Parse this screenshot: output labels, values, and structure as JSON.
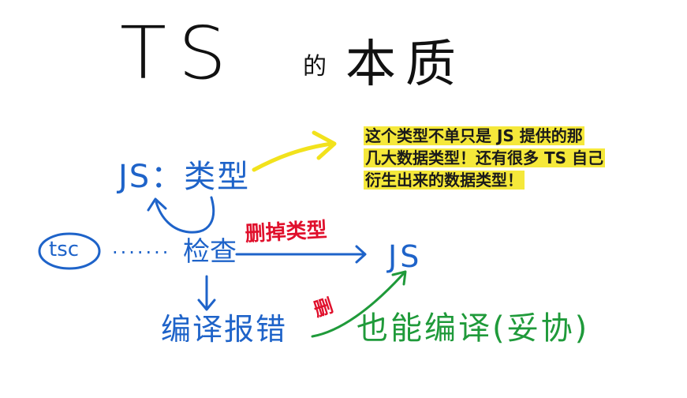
{
  "title": {
    "ts": "TS",
    "de": "的",
    "rest": "本质"
  },
  "note": {
    "line1": "这个类型不单只是 JS 提供的那",
    "line2": "几大数据类型！还有很多 TS 自己",
    "line3": "衍生出来的数据类型！"
  },
  "diagram": {
    "js_types": "JS：类型",
    "tsc": "tsc",
    "dots": "·······",
    "check": "检查",
    "remove_types": "删掉类型",
    "js_output": "JS",
    "compile_error": "编译报错",
    "remove_small": "删",
    "still_compile": "也能编译(妥协)"
  },
  "colors": {
    "blue_ink": "#1e63c9",
    "red_ink": "#e0102c",
    "green_ink": "#1f9a3a",
    "yellow_ink": "#f2e21c",
    "highlight": "#f5e83a"
  }
}
